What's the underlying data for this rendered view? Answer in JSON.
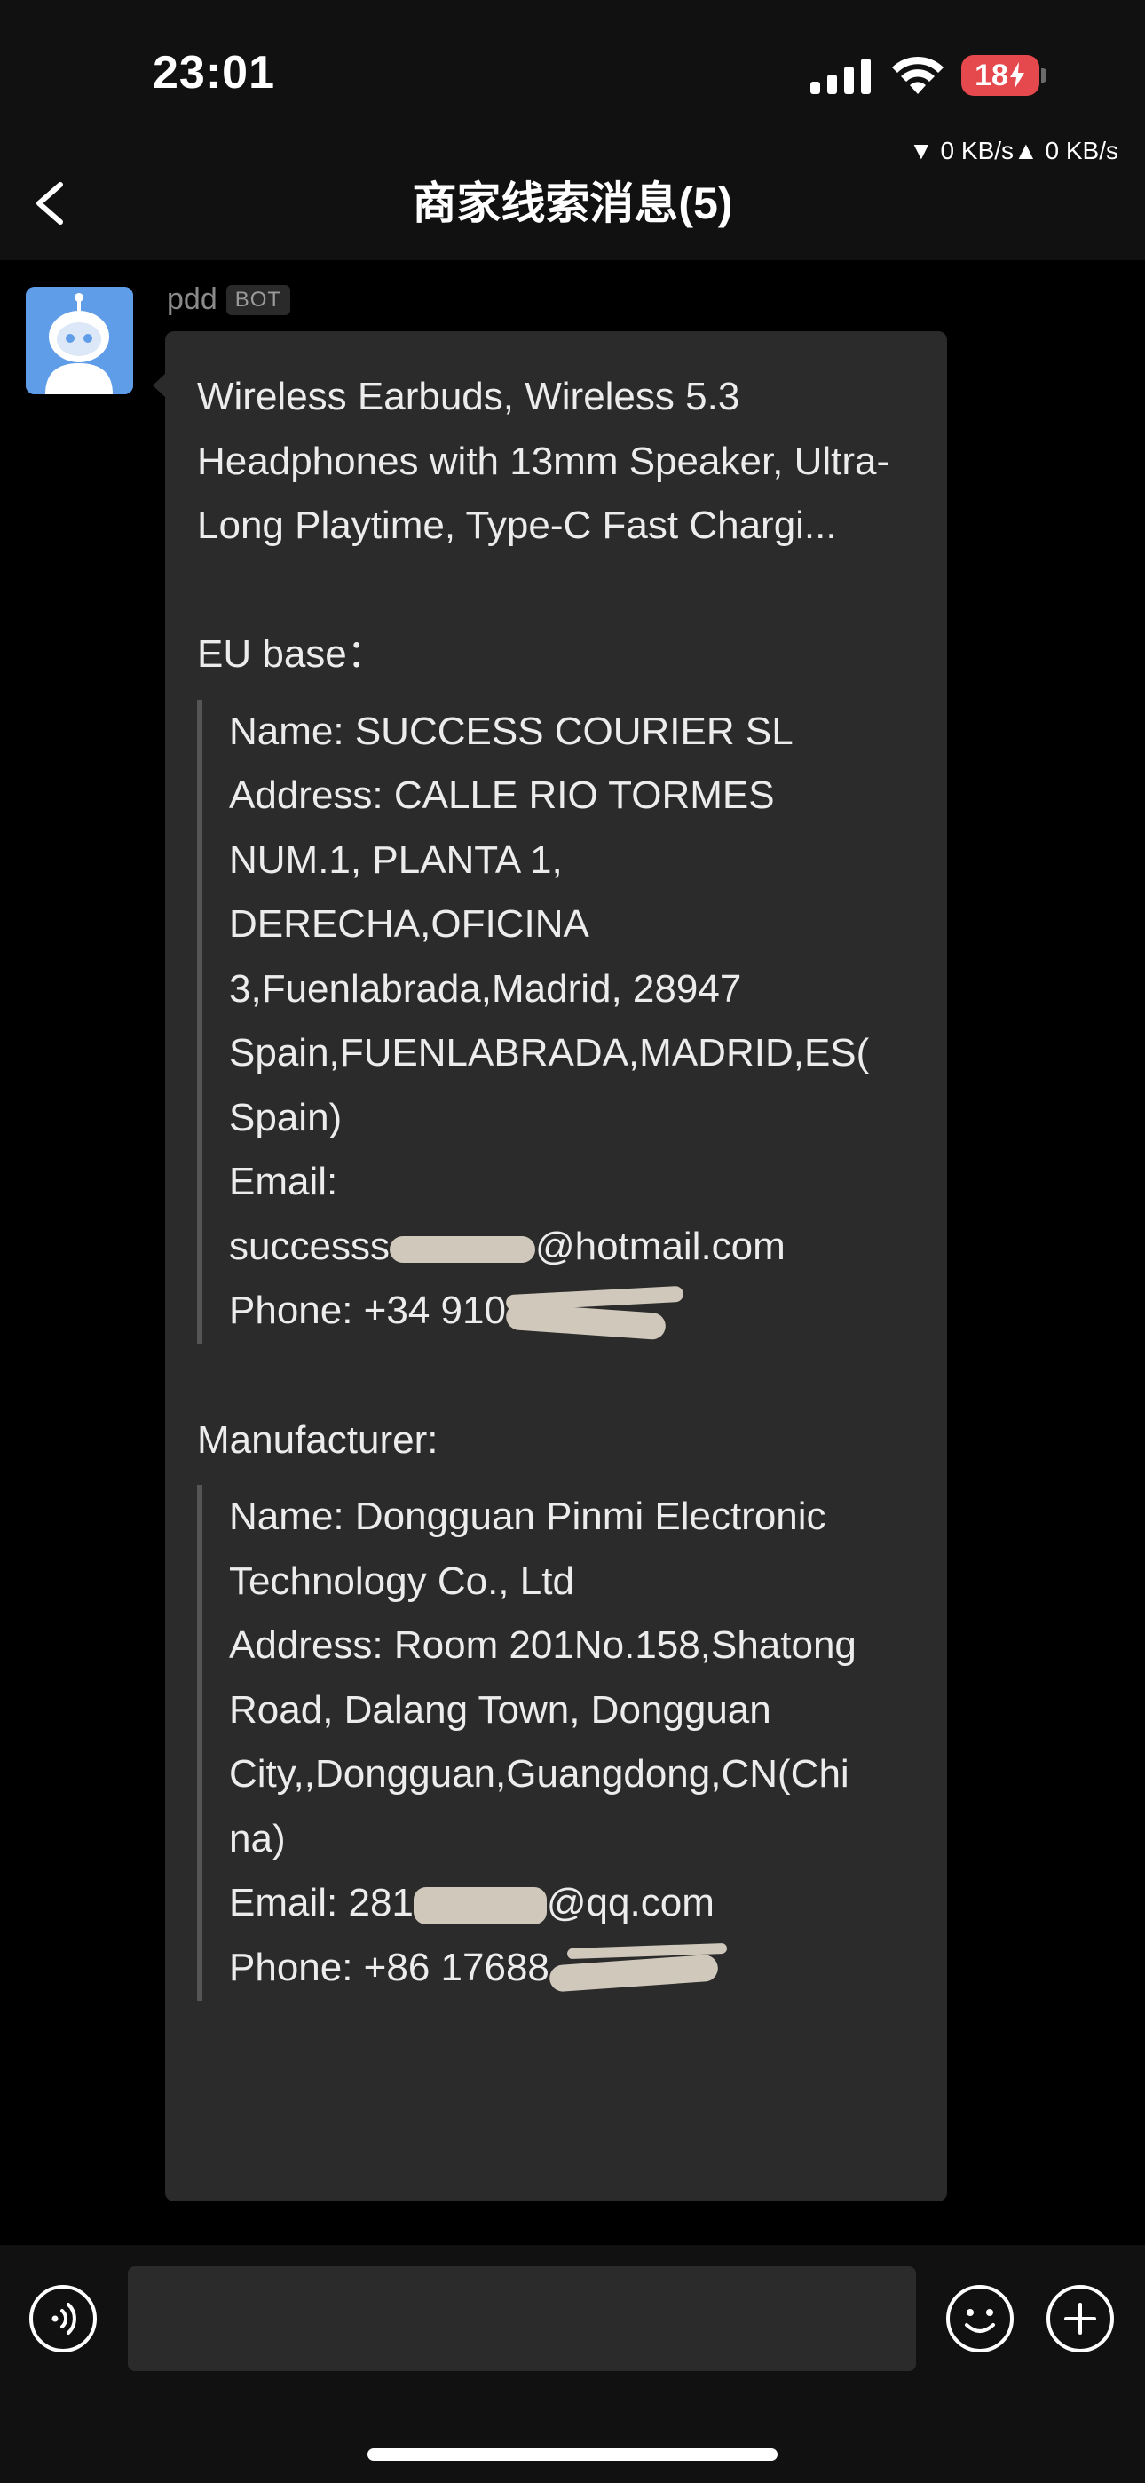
{
  "status_bar": {
    "time": "23:01",
    "battery": "18",
    "net_speed": "▼ 0 KB/s▲ 0 KB/s"
  },
  "header": {
    "title": "商家线索消息(5)"
  },
  "message": {
    "sender": "pdd",
    "badge": "BOT",
    "product": "Wireless Earbuds, Wireless 5.3 Headphones with 13mm Speaker, Ultra-Long Playtime, Type-C Fast Chargi...",
    "eu_label": "EU base：",
    "eu_lines": [
      "Name: SUCCESS COURIER SL",
      "Address: CALLE RIO TORMES",
      "NUM.1, PLANTA 1,",
      "DERECHA,OFICINA",
      "3,Fuenlabrada,Madrid, 28947",
      "Spain,FUENLABRADA,MADRID,ES(",
      "Spain)",
      "Email:"
    ],
    "eu_email_start": "successs",
    "eu_email_end": "@hotmail.com",
    "eu_phone_start": "Phone: +34 910",
    "manufacturer_label": "Manufacturer:",
    "mfr_lines": [
      "Name: Dongguan Pinmi Electronic",
      "Technology Co., Ltd",
      "Address: Room 201No.158,Shatong",
      "Road, Dalang Town, Dongguan",
      "City,,Dongguan,Guangdong,CN(Chi",
      "na)"
    ],
    "mfr_email_start": "Email: 281",
    "mfr_email_end": "@qq.com",
    "mfr_phone_start": "Phone: +86 17688"
  },
  "colors": {
    "background": "#000000",
    "header_bg": "#111111",
    "bubble_bg": "#2b2b2b",
    "avatar_bg": "#5f9de8",
    "battery": "#e5484d",
    "redaction": "#cfc8bb"
  },
  "icons": {
    "back": "chevron-left-icon",
    "voice": "voice-icon",
    "emoji": "emoji-icon",
    "plus": "plus-icon"
  }
}
